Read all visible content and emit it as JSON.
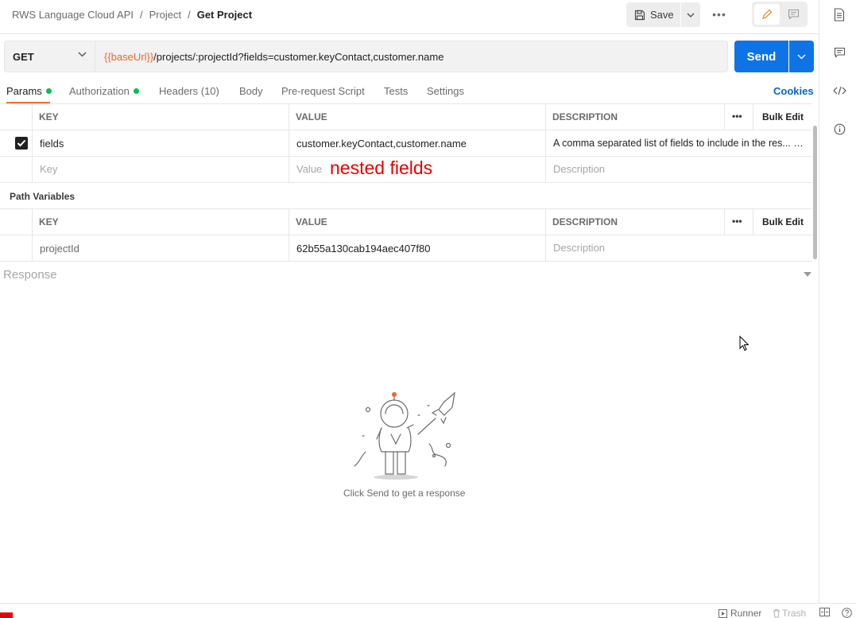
{
  "breadcrumb": {
    "items": [
      "RWS Language Cloud API",
      "Project"
    ],
    "separator": "/",
    "current": "Get Project"
  },
  "toolbar": {
    "save_label": "Save",
    "more_label": "•••"
  },
  "request": {
    "method": "GET",
    "url_variable": "{{baseUrl}}",
    "url_path": "/projects/:projectId?fields=customer.keyContact,customer.name",
    "send_label": "Send"
  },
  "tabs": [
    {
      "label": "Params",
      "active": true,
      "dot": true
    },
    {
      "label": "Authorization",
      "active": false,
      "dot": true
    },
    {
      "label": "Headers (10)",
      "active": false,
      "dot": false
    },
    {
      "label": "Body",
      "active": false,
      "dot": false
    },
    {
      "label": "Pre-request Script",
      "active": false,
      "dot": false
    },
    {
      "label": "Tests",
      "active": false,
      "dot": false
    },
    {
      "label": "Settings",
      "active": false,
      "dot": false
    }
  ],
  "cookies_label": "Cookies",
  "params_table": {
    "columns": [
      "KEY",
      "VALUE",
      "DESCRIPTION"
    ],
    "more_label": "•••",
    "bulk_edit_label": "Bulk Edit",
    "rows": [
      {
        "checked": true,
        "key": "fields",
        "value": "customer.keyContact,customer.name",
        "description": "A comma separated list of fields to include in the res... …"
      }
    ],
    "placeholders": {
      "key": "Key",
      "value": "Value",
      "description": "Description"
    }
  },
  "annotation": "nested fields",
  "path_variables": {
    "title": "Path Variables",
    "columns": [
      "KEY",
      "VALUE",
      "DESCRIPTION"
    ],
    "more_label": "•••",
    "bulk_edit_label": "Bulk Edit",
    "rows": [
      {
        "key": "projectId",
        "value": "62b55a130cab194aec407f80",
        "description_placeholder": "Description"
      }
    ]
  },
  "response": {
    "label": "Response",
    "empty_text": "Click Send to get a response"
  },
  "status_bar": {
    "runner_label": "Runner",
    "trash_label": "Trash"
  },
  "icons": {
    "right_sidebar": [
      "document-icon",
      "comment-icon",
      "code-icon",
      "info-icon"
    ]
  },
  "colors": {
    "accent": "#ff6c37",
    "send": "#0e74e6",
    "variable": "#e8692f",
    "active_dot": "#0cbb52",
    "annotation": "#e60000",
    "link": "#0b63c5"
  }
}
